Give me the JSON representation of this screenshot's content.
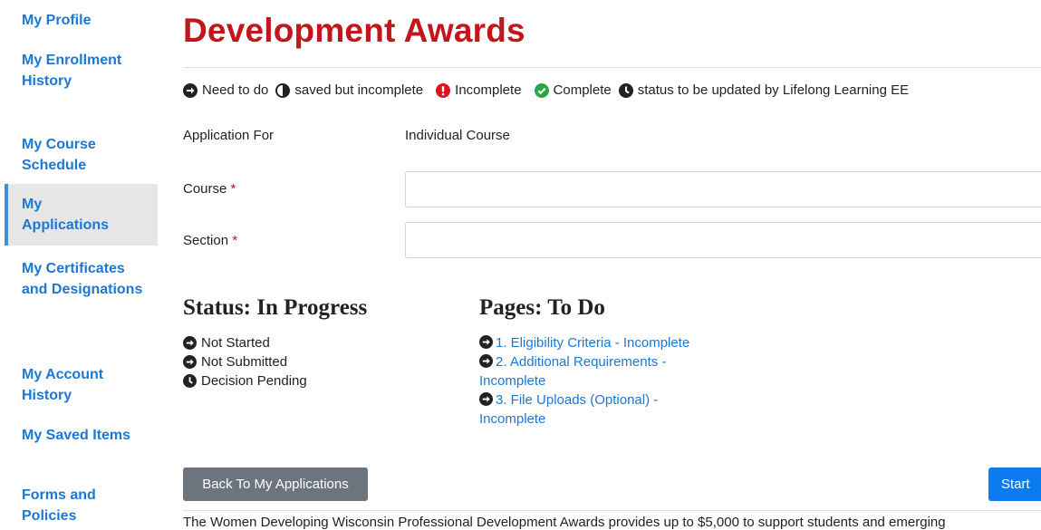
{
  "sidebar": {
    "items": [
      {
        "label": "My Profile"
      },
      {
        "label": "My Enrollment History"
      },
      {
        "label": "My Course Schedule"
      },
      {
        "label": "My Applications"
      },
      {
        "label": "My Certificates and Designations"
      },
      {
        "label": "My Account History"
      },
      {
        "label": "My Saved Items"
      },
      {
        "label": "Forms and Policies"
      }
    ],
    "active_index": 3
  },
  "page": {
    "title": "Development Awards"
  },
  "legend": {
    "need_to_do": "Need to do",
    "saved_incomplete": "saved but incomplete",
    "incomplete": "Incomplete",
    "complete": "Complete",
    "pending": "status to be updated by Lifelong Learning EE"
  },
  "form": {
    "application_for_label": "Application For",
    "application_for_value": "Individual Course",
    "course_label": "Course",
    "section_label": "Section",
    "required_mark": "*",
    "course_value": "",
    "section_value": ""
  },
  "status": {
    "heading": "Status: In Progress",
    "items": [
      "Not Started",
      "Not Submitted",
      "Decision Pending"
    ]
  },
  "pages": {
    "heading": "Pages: To Do",
    "items": [
      "1. Eligibility Criteria - Incomplete",
      "2. Additional Requirements - Incomplete",
      "3. File Uploads (Optional) - Incomplete"
    ]
  },
  "buttons": {
    "back": "Back To My Applications",
    "start": "Start"
  },
  "footer_text": "The Women Developing Wisconsin Professional Development Awards provides up to $5,000 to support students and emerging",
  "colors": {
    "title": "#c2151c",
    "link": "#1b78d3",
    "incomplete_icon": "#e0141b",
    "complete_icon": "#28a745",
    "start_button": "#0d7bf0",
    "back_button": "#6c757d"
  },
  "icons": {
    "need_to_do": "arrow-circle-right-icon",
    "saved_incomplete": "half-circle-icon",
    "incomplete": "exclamation-circle-icon",
    "complete": "check-circle-icon",
    "pending": "clock-icon"
  }
}
